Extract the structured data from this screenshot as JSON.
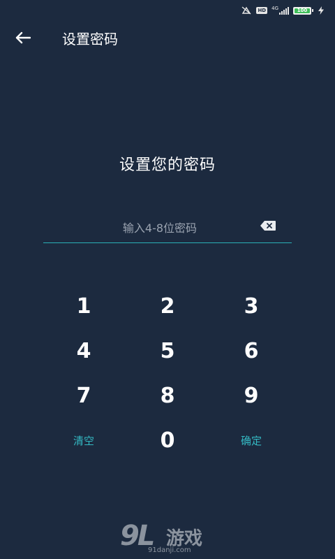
{
  "status_bar": {
    "network_label": "4G",
    "hd_label": "HD",
    "battery_level": "100",
    "battery_fraction": 1.0,
    "icons": [
      "no-sim-icon",
      "hd-icon",
      "signal-icon",
      "battery-icon",
      "charging-icon"
    ]
  },
  "app_bar": {
    "back_icon": "arrow-left-icon",
    "title": "设置密码"
  },
  "main": {
    "prompt": "设置您的密码",
    "password_field": {
      "placeholder": "输入4-8位密码",
      "value": "",
      "clear_icon": "backspace-icon"
    },
    "keypad": {
      "keys": [
        {
          "label": "1",
          "kind": "digit"
        },
        {
          "label": "2",
          "kind": "digit"
        },
        {
          "label": "3",
          "kind": "digit"
        },
        {
          "label": "4",
          "kind": "digit"
        },
        {
          "label": "5",
          "kind": "digit"
        },
        {
          "label": "6",
          "kind": "digit"
        },
        {
          "label": "7",
          "kind": "digit"
        },
        {
          "label": "8",
          "kind": "digit"
        },
        {
          "label": "9",
          "kind": "digit"
        },
        {
          "label": "清空",
          "kind": "action"
        },
        {
          "label": "0",
          "kind": "digit"
        },
        {
          "label": "确定",
          "kind": "action"
        }
      ]
    }
  },
  "watermark": {
    "logo": "9L",
    "name": "游戏",
    "domain": "91danji.com"
  },
  "colors": {
    "background": "#1c2a3f",
    "accent": "#34b9c3",
    "underline": "#2bb0b7",
    "text": "#ffffff",
    "placeholder": "#9aa3b0"
  }
}
